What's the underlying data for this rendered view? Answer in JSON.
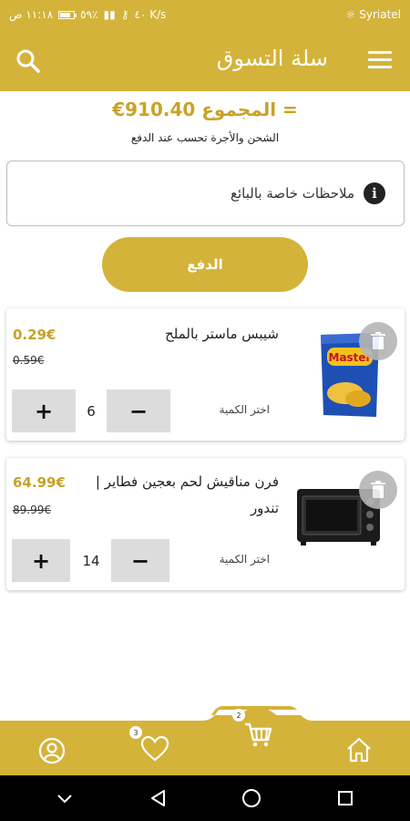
{
  "status_bar": {
    "time": "١١:١٨ ص",
    "battery": "٥٩٪",
    "speed": "٤٠ K/s",
    "carrier": "Syriatel"
  },
  "header": {
    "title": "سلة التسوق"
  },
  "summary": {
    "total_label": "المجموع =",
    "total_value": "€910.40",
    "shipping_note": "الشحن والأجرة تحسب عند الدفع"
  },
  "notes": {
    "placeholder": "ملاحظات خاصة بالبائع"
  },
  "pay_button": {
    "label": "الدفع"
  },
  "items": [
    {
      "name": "شيبس ماستر بالملح",
      "price": "0.29€",
      "old_price": "0.59€",
      "qty_label": "اختر الكمية",
      "quantity": "6",
      "image_text": "Master"
    },
    {
      "name": "فرن مناقيش لحم بعجين فطاير | تندور",
      "price": "64.99€",
      "old_price": "89.99€",
      "qty_label": "اختر الكمية",
      "quantity": "14"
    }
  ],
  "bottom_nav": {
    "favorites_count": "3",
    "cart_count": "2"
  },
  "colors": {
    "accent": "#d4b33a",
    "price": "#c9a227"
  }
}
